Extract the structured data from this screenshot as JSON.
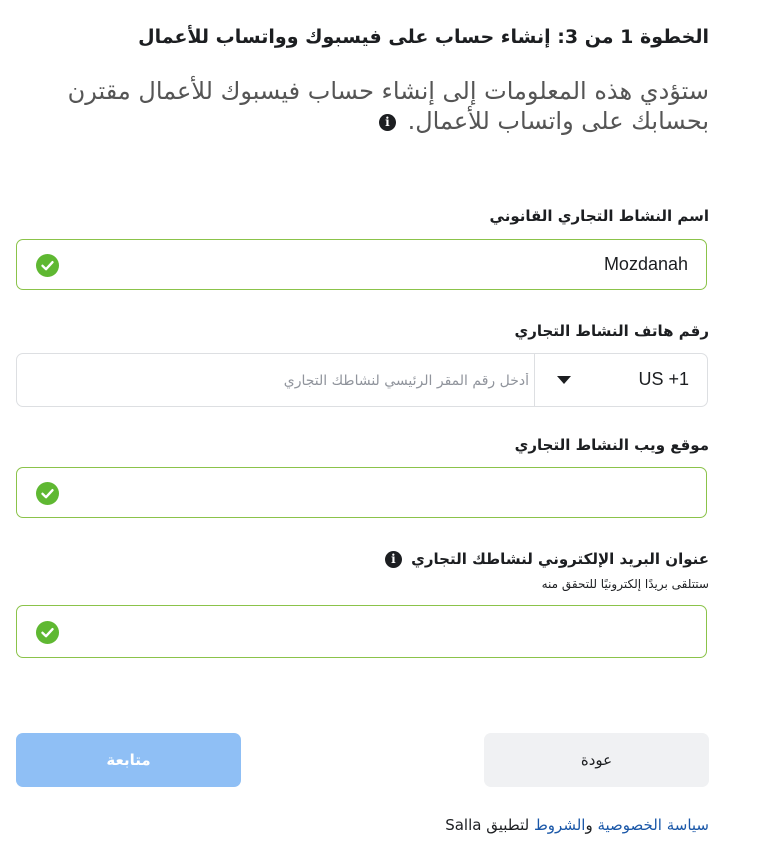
{
  "header": {
    "step_title": "الخطوة 1 من 3: إنشاء حساب على فيسبوك وواتساب للأعمال",
    "subtitle": "ستؤدي هذه المعلومات إلى إنشاء حساب فيسبوك للأعمال مقترن بحسابك على واتساب للأعمال.",
    "info_icon": "info-icon"
  },
  "form": {
    "legal_name": {
      "label": "اسم النشاط التجاري القانوني",
      "value": "Mozdanah",
      "status_icon": "check-icon"
    },
    "phone": {
      "label": "رقم هاتف النشاط التجاري",
      "country_code": "US +1",
      "placeholder": "أدخل رقم المقر الرئيسي لنشاطك التجاري",
      "value": ""
    },
    "website": {
      "label": "موقع ويب النشاط التجاري",
      "value": "",
      "status_icon": "check-icon"
    },
    "email": {
      "label": "عنوان البريد الإلكتروني لنشاطك التجاري",
      "hint": "ستتلقى بريدًا إلكترونيًا للتحقق منه",
      "value": "",
      "status_icon": "check-icon"
    }
  },
  "actions": {
    "continue_label": "متابعة",
    "back_label": "عودة"
  },
  "footer": {
    "privacy_link": "سياسة الخصوصية",
    "and": " و",
    "terms_link": "الشروط",
    "suffix": " لتطبيق Salla"
  },
  "colors": {
    "success": "#5fb832",
    "field_border_valid": "#8bc34a",
    "primary_disabled": "#8fbff5",
    "link": "#1a57a8"
  }
}
